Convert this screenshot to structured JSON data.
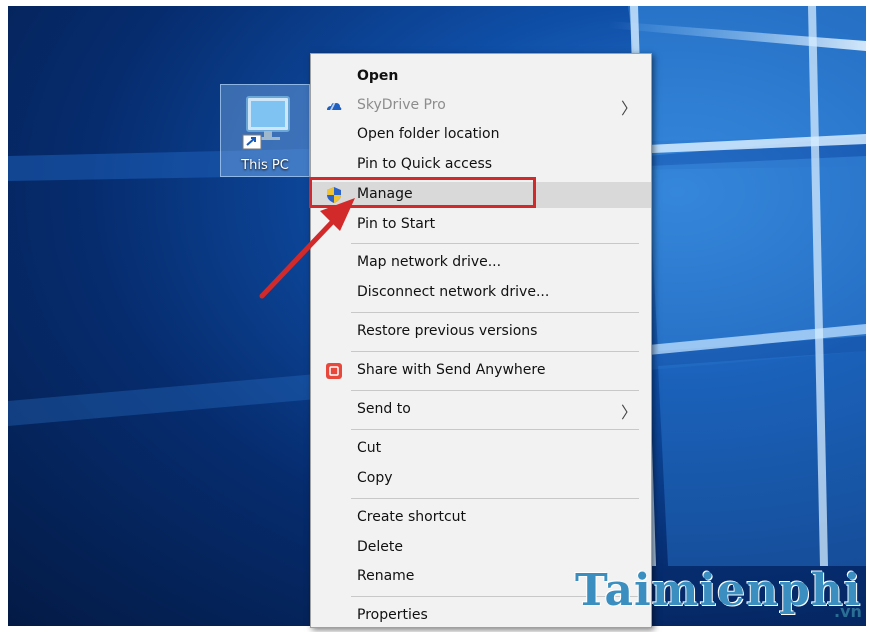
{
  "desktop": {
    "icon_label": "This PC",
    "icon_name": "computer-icon"
  },
  "context_menu": {
    "items": [
      {
        "label": "Open",
        "bold": true
      },
      {
        "label": "SkyDrive Pro",
        "disabled": true,
        "submenu": true,
        "icon": "skydrive-icon"
      },
      {
        "label": "Open folder location"
      },
      {
        "label": "Pin to Quick access"
      },
      {
        "label": "Manage",
        "icon": "uac-shield-icon",
        "highlighted": true
      },
      {
        "label": "Pin to Start"
      },
      {
        "label": "Map network drive..."
      },
      {
        "label": "Disconnect network drive..."
      },
      {
        "label": "Restore previous versions"
      },
      {
        "label": "Share with Send Anywhere",
        "icon": "send-anywhere-icon"
      },
      {
        "label": "Send to",
        "submenu": true
      },
      {
        "label": "Cut"
      },
      {
        "label": "Copy"
      },
      {
        "label": "Create shortcut"
      },
      {
        "label": "Delete"
      },
      {
        "label": "Rename"
      },
      {
        "label": "Properties"
      }
    ],
    "submenu_glyph": "〉"
  },
  "annotation": {
    "highlight_color": "#d22a2a",
    "arrow_color": "#d22a2a"
  },
  "watermark": {
    "text": "Taimienphi",
    "sub": ".vn"
  }
}
